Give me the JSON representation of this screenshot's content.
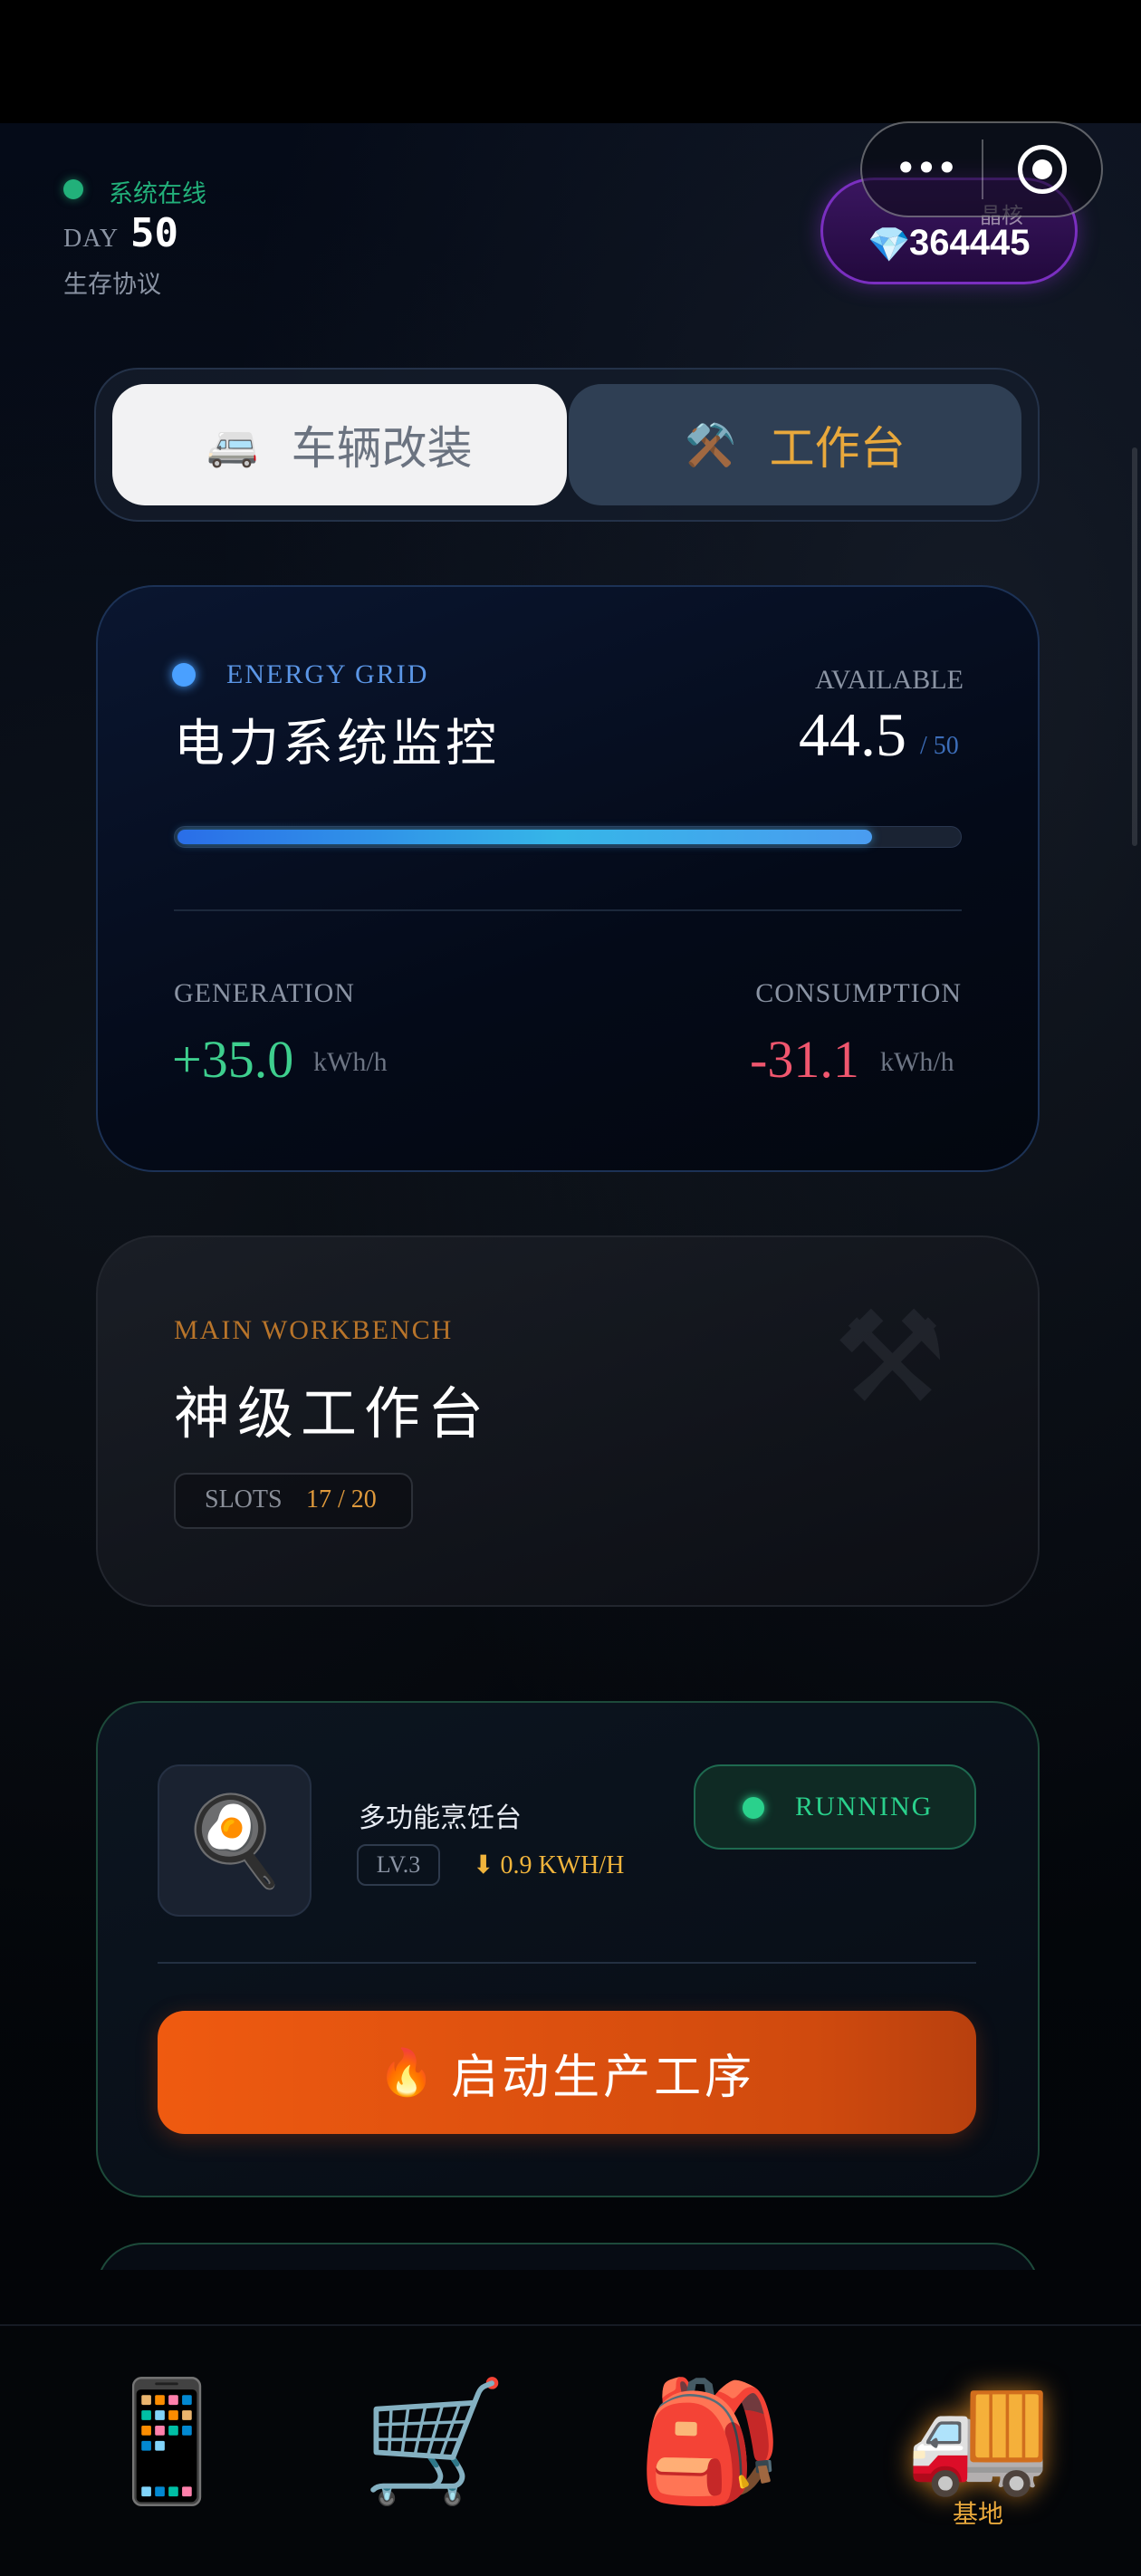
{
  "header": {
    "online_text": "系统在线",
    "day_label": "DAY",
    "day_value": "50",
    "protocol_text": "生存协议",
    "gem": {
      "label": "晶核",
      "value": "364445",
      "icon": "gem-icon"
    }
  },
  "capsule": {
    "more_label": "•••",
    "icons": [
      "more-dots-icon",
      "target-icon"
    ]
  },
  "tabs": [
    {
      "label": "车辆改装",
      "icon": "🚐",
      "active": false
    },
    {
      "label": "工作台",
      "icon": "⚒️",
      "active": true
    }
  ],
  "energy": {
    "tag": "ENERGY GRID",
    "title": "电力系统监控",
    "available_label": "AVAILABLE",
    "available_value": "44.5",
    "available_max": "/ 50",
    "fill_fraction": 0.89,
    "generation_label": "GENERATION",
    "generation_value": "+35.0",
    "generation_unit": "kWh/h",
    "consumption_label": "CONSUMPTION",
    "consumption_value": "-31.1",
    "consumption_unit": "kWh/h"
  },
  "workbench": {
    "tag": "MAIN WORKBENCH",
    "title": "神级工作台",
    "slots_label": "SLOTS",
    "slots_value": "17 / 20",
    "bg_icon": "⚒"
  },
  "machine": {
    "icon": "🍳",
    "name": "多功能烹饪台",
    "level": "LV.3",
    "power": "⬇ 0.9 KWH/H",
    "status": "RUNNING",
    "start_icon": "🔥",
    "start_label": "启动生产工序"
  },
  "nav": {
    "items": [
      {
        "name": "phone",
        "icon": "📱",
        "label": ""
      },
      {
        "name": "cart",
        "icon": "🛒",
        "label": ""
      },
      {
        "name": "bag",
        "icon": "🎒",
        "label": ""
      },
      {
        "name": "base",
        "icon": "🚚",
        "label": "基地",
        "active": true
      }
    ]
  },
  "colors": {
    "accent_orange": "#e8a83c",
    "online_green": "#22b07a",
    "gem_purple": "#7a2fc0",
    "energy_blue": "#4aa0ff",
    "generation_green": "#3ecf8e",
    "consumption_red": "#f0566e",
    "start_button": "#ef5a10"
  }
}
